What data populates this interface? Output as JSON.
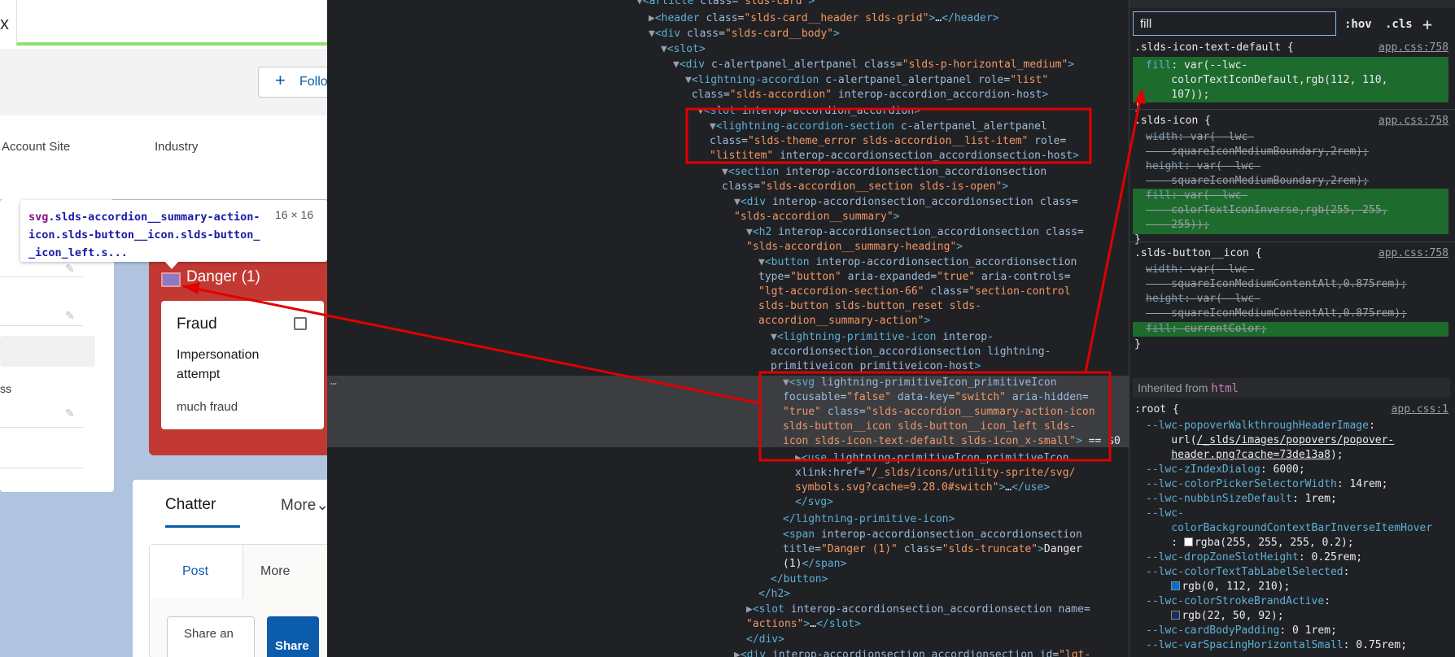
{
  "app": {
    "close_glyph": "x",
    "follow_button": "Follo",
    "fields": {
      "account_site": "Account Site",
      "industry": "Industry"
    },
    "side_text": "ss",
    "tooltip": {
      "selector_tag": "svg",
      "selector_rest": ".slds-accordion__summary-action-icon.slds-button__icon.slds-button__icon_left.s...",
      "size": "16 × 16"
    },
    "alert": {
      "title": "Danger (1)",
      "card_title": "Fraud",
      "line1": "Impersonation",
      "line2": "attempt",
      "line3": "much fraud"
    },
    "chatter": {
      "tab": "Chatter",
      "more_tab": "More",
      "post": "Post",
      "more": "More",
      "share_placeholder": "Share an",
      "share_button": "Share"
    }
  },
  "elements": {
    "lines": [
      {
        "indent": 0,
        "tri": "▼",
        "html": "article_slds_card"
      },
      {
        "indent": 1,
        "tri": "▶",
        "html": "header"
      },
      {
        "indent": 1,
        "tri": "▼",
        "html": "div_card_body"
      }
    ]
  },
  "styles": {
    "filter_value": "fill",
    "hov": ":hov",
    "cls": ".cls",
    "add": "+",
    "source": "app.css:758",
    "source_root": "app.css:1",
    "inherited_label": "Inherited from",
    "inherited_tag": "html"
  },
  "annotation_color": "#e00000"
}
